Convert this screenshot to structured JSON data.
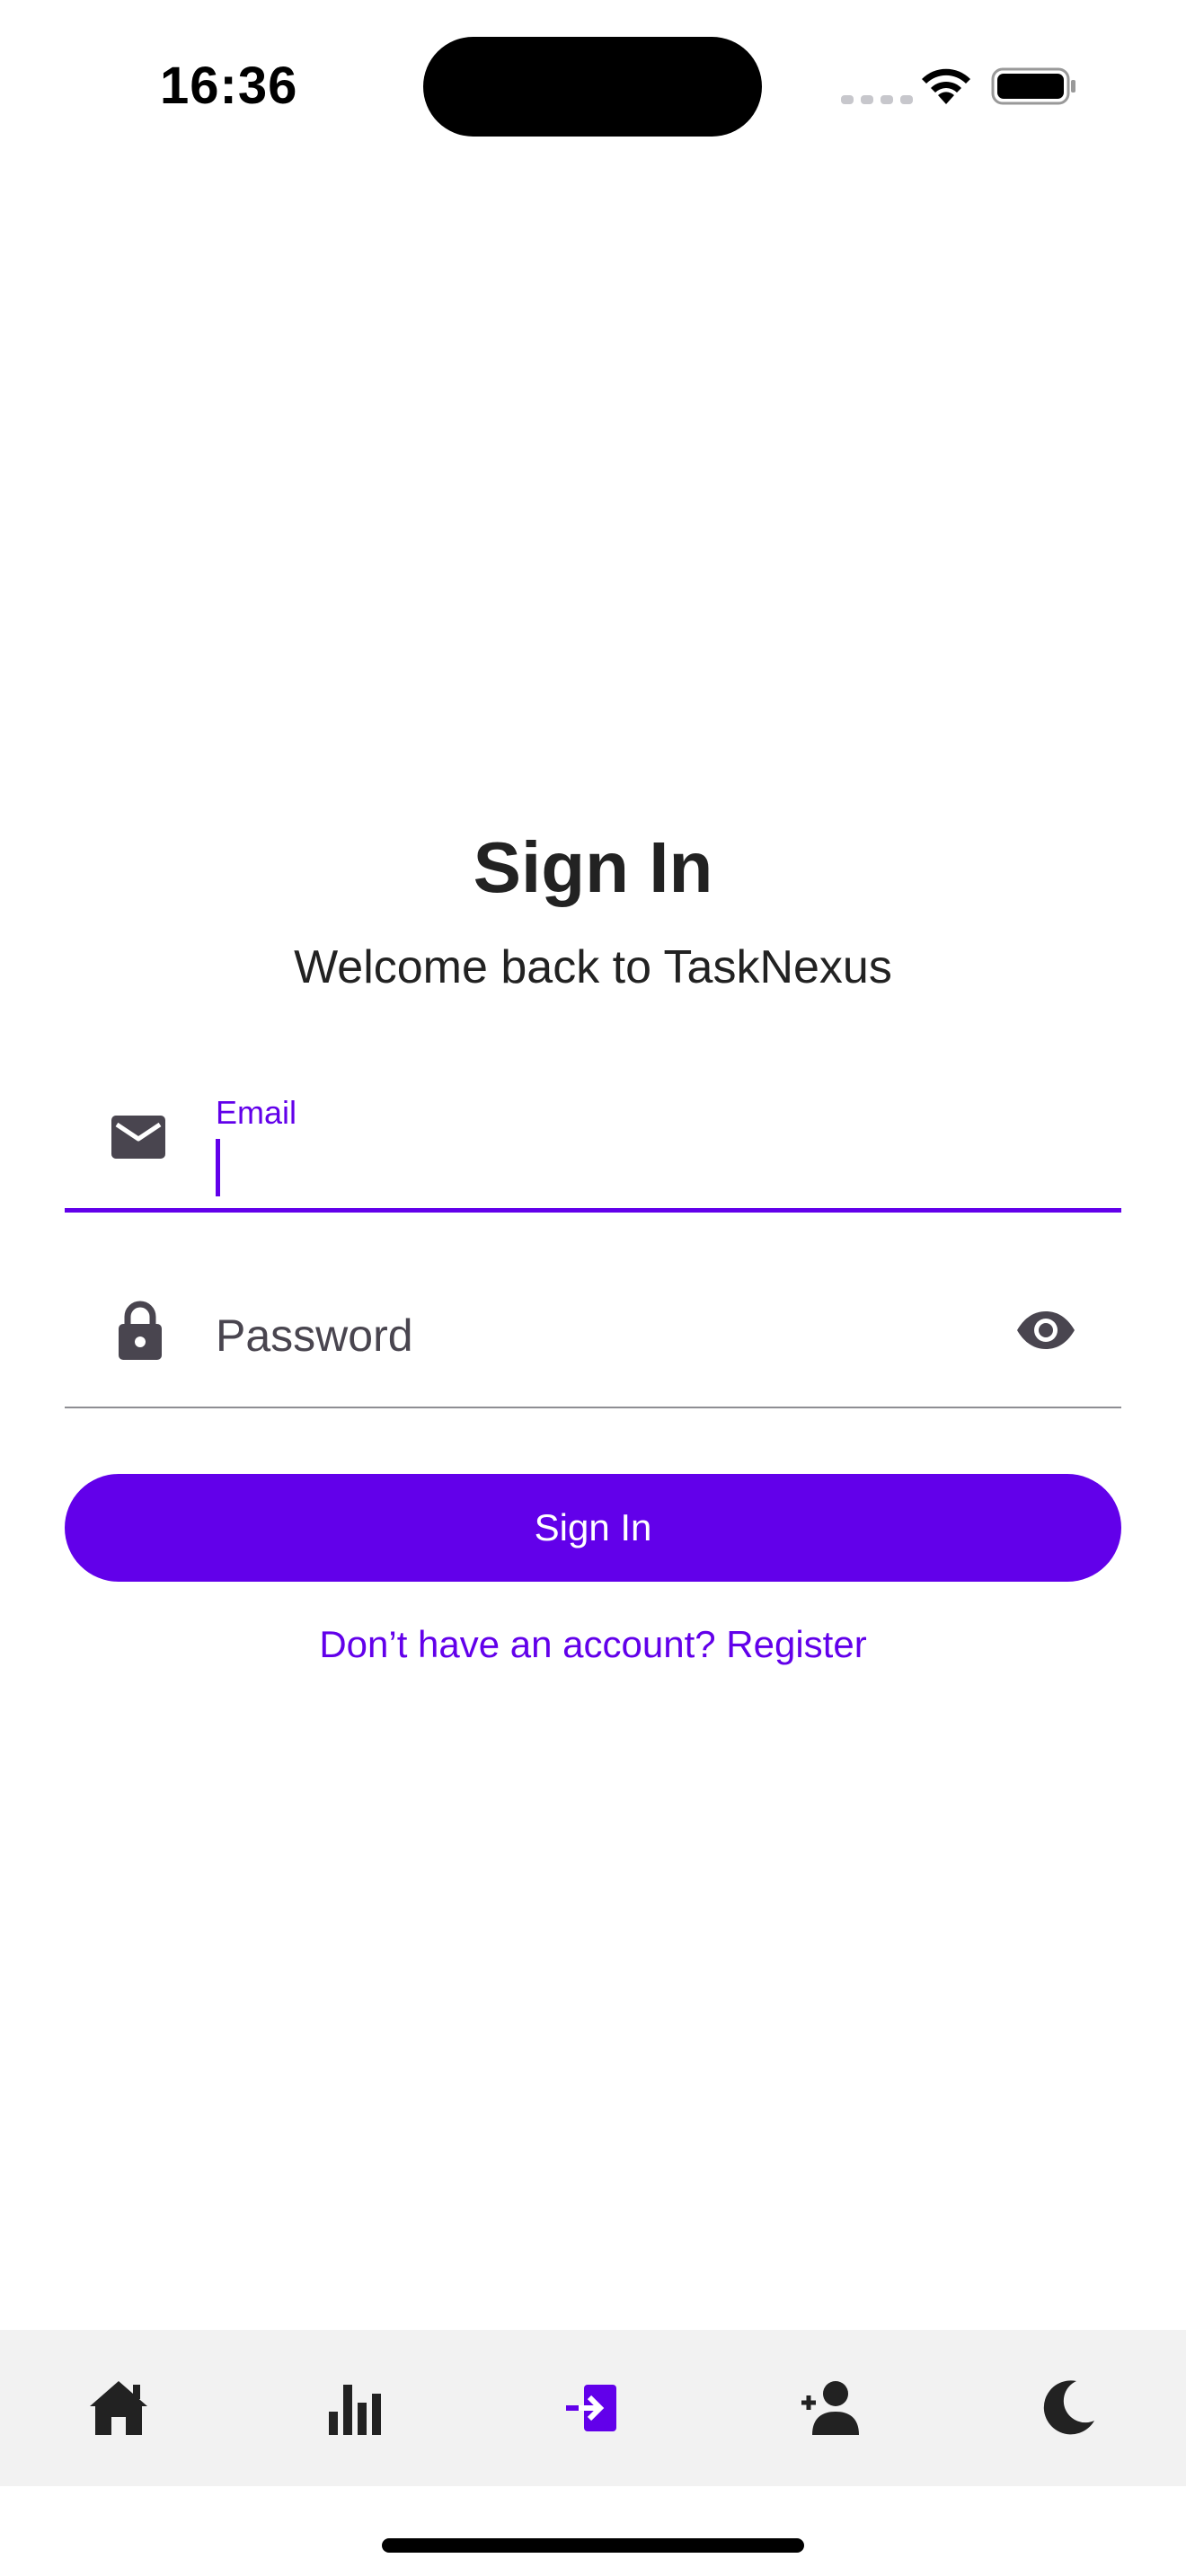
{
  "status_bar": {
    "time": "16:36"
  },
  "header": {
    "title": "Sign In",
    "subtitle": "Welcome back to TaskNexus"
  },
  "form": {
    "email": {
      "label": "Email",
      "value": "",
      "icon": "mail-icon"
    },
    "password": {
      "placeholder": "Password",
      "value": "",
      "icon": "lock-icon",
      "toggle_icon": "eye-icon"
    },
    "submit_label": "Sign In",
    "register_link": "Don’t have an account? Register"
  },
  "bottom_nav": {
    "items": [
      {
        "icon": "home-icon",
        "active": false
      },
      {
        "icon": "bar-chart-icon",
        "active": false
      },
      {
        "icon": "login-icon",
        "active": true
      },
      {
        "icon": "add-user-icon",
        "active": false
      },
      {
        "icon": "dark-mode-moon-icon",
        "active": false
      }
    ]
  },
  "colors": {
    "accent": "#6200ea",
    "text": "#222222",
    "icon": "#49454f",
    "nav_background": "#f2f2f2"
  }
}
